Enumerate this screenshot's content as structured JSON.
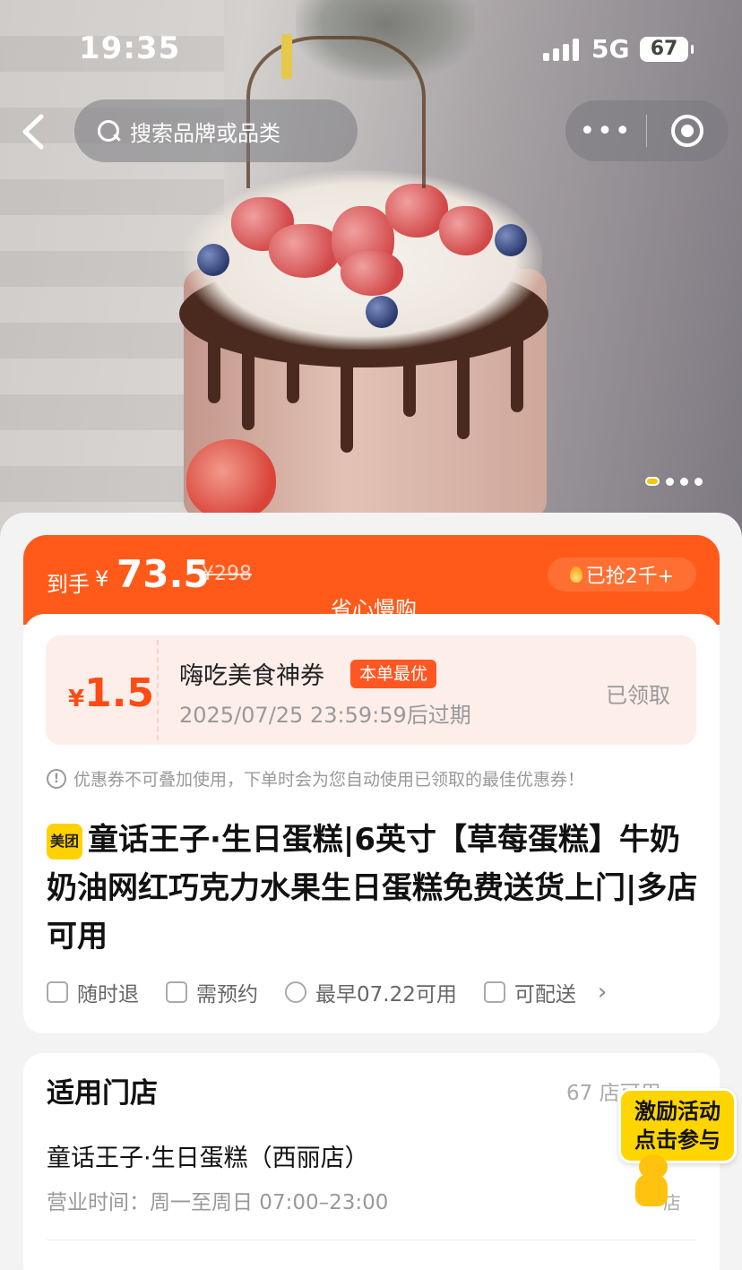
{
  "status_bar": {
    "time": "19:35",
    "network": "5G",
    "battery": "67"
  },
  "nav": {
    "search_placeholder": "搜索品牌或品类",
    "more": "•••"
  },
  "hero": {
    "page_count": 5,
    "active_page": 1
  },
  "price": {
    "label": "到手",
    "currency": "¥",
    "value": "73.5",
    "original": "¥298",
    "sold": "已抢2千+",
    "brand_tag": "省心慢购",
    "accent_color": "#ff5a1a"
  },
  "coupon": {
    "currency": "¥",
    "amount": "1.5",
    "title": "嗨吃美食神券",
    "badge": "本单最优",
    "expiry": "2025/07/25 23:59:59后过期",
    "status": "已领取"
  },
  "notice": "优惠券不可叠加使用，下单时会为您自动使用已领取的最佳优惠券！",
  "product": {
    "platform_logo": "美团",
    "title": "童话王子·生日蛋糕|6英寸【草莓蛋糕】牛奶奶油网红巧克力水果生日蛋糕免费送货上门|多店可用"
  },
  "features": [
    {
      "icon": "receipt-icon",
      "label": "随时退"
    },
    {
      "icon": "calendar-icon",
      "label": "需预约"
    },
    {
      "icon": "check-circle-icon",
      "label": "最早07.22可用"
    },
    {
      "icon": "delivery-icon",
      "label": "可配送"
    }
  ],
  "stores": {
    "heading": "适用门店",
    "count": "67 店可用",
    "first_store": {
      "name": "童话王子·生日蛋糕（西丽店）",
      "hours": "营业时间：周一至周日 07:00–23:00",
      "distance": "店"
    }
  },
  "promo": {
    "line1": "激励活动",
    "line2": "点击参与"
  }
}
